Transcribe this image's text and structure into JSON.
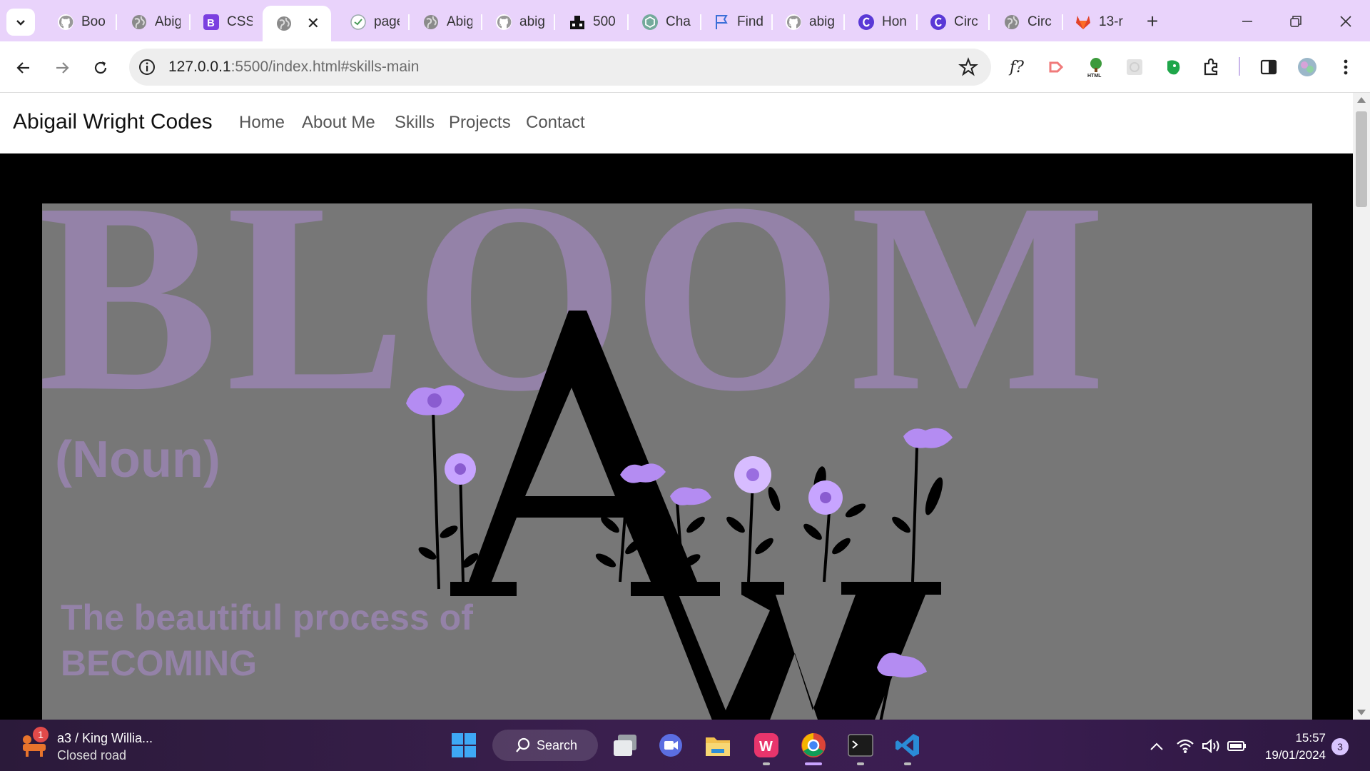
{
  "browser": {
    "tabs": [
      {
        "label": "Boo",
        "icon": "github-icon"
      },
      {
        "label": "Abig",
        "icon": "globe-icon"
      },
      {
        "label": "CSS",
        "icon": "bootstrap-icon"
      },
      {
        "label": "",
        "icon": "globe-icon",
        "active": true
      },
      {
        "label": "page",
        "icon": "github-copilot-icon"
      },
      {
        "label": "Abig",
        "icon": "globe-icon"
      },
      {
        "label": "abig",
        "icon": "github-icon"
      },
      {
        "label": "500",
        "icon": "server-icon"
      },
      {
        "label": "Cha",
        "icon": "chatgpt-icon"
      },
      {
        "label": "Find",
        "icon": "flag-icon"
      },
      {
        "label": "abig",
        "icon": "github-icon"
      },
      {
        "label": "Hon",
        "icon": "canva-icon"
      },
      {
        "label": "Circ",
        "icon": "canva-icon"
      },
      {
        "label": "Circ",
        "icon": "globe-icon"
      },
      {
        "label": "13-r",
        "icon": "gitlab-icon"
      }
    ],
    "new_tab": "+",
    "close_glyph": "✕",
    "url_host": "127.0.0.1",
    "url_rest": ":5500/index.html#skills-main"
  },
  "site": {
    "brand": "Abigail Wright Codes",
    "nav": [
      "Home",
      "About Me",
      "Skills",
      "Projects",
      "Contact"
    ],
    "hero": {
      "headline": "BLOOM",
      "part_of_speech": "(Noun)",
      "tagline_line1": "The beautiful process of",
      "tagline_line2": "BECOMING"
    }
  },
  "colors": {
    "tab_strip": "#e9d3fb",
    "hero_bg": "#777777",
    "hero_text": "#9482a8",
    "flower": "#b48cf2",
    "taskbar": "#2b1a3a"
  },
  "taskbar": {
    "weather_badge": "1",
    "weather_title": "a3 / King Willia...",
    "weather_sub": "Closed road",
    "search_label": "Search",
    "time": "15:57",
    "date": "19/01/2024",
    "notifications": "3"
  }
}
